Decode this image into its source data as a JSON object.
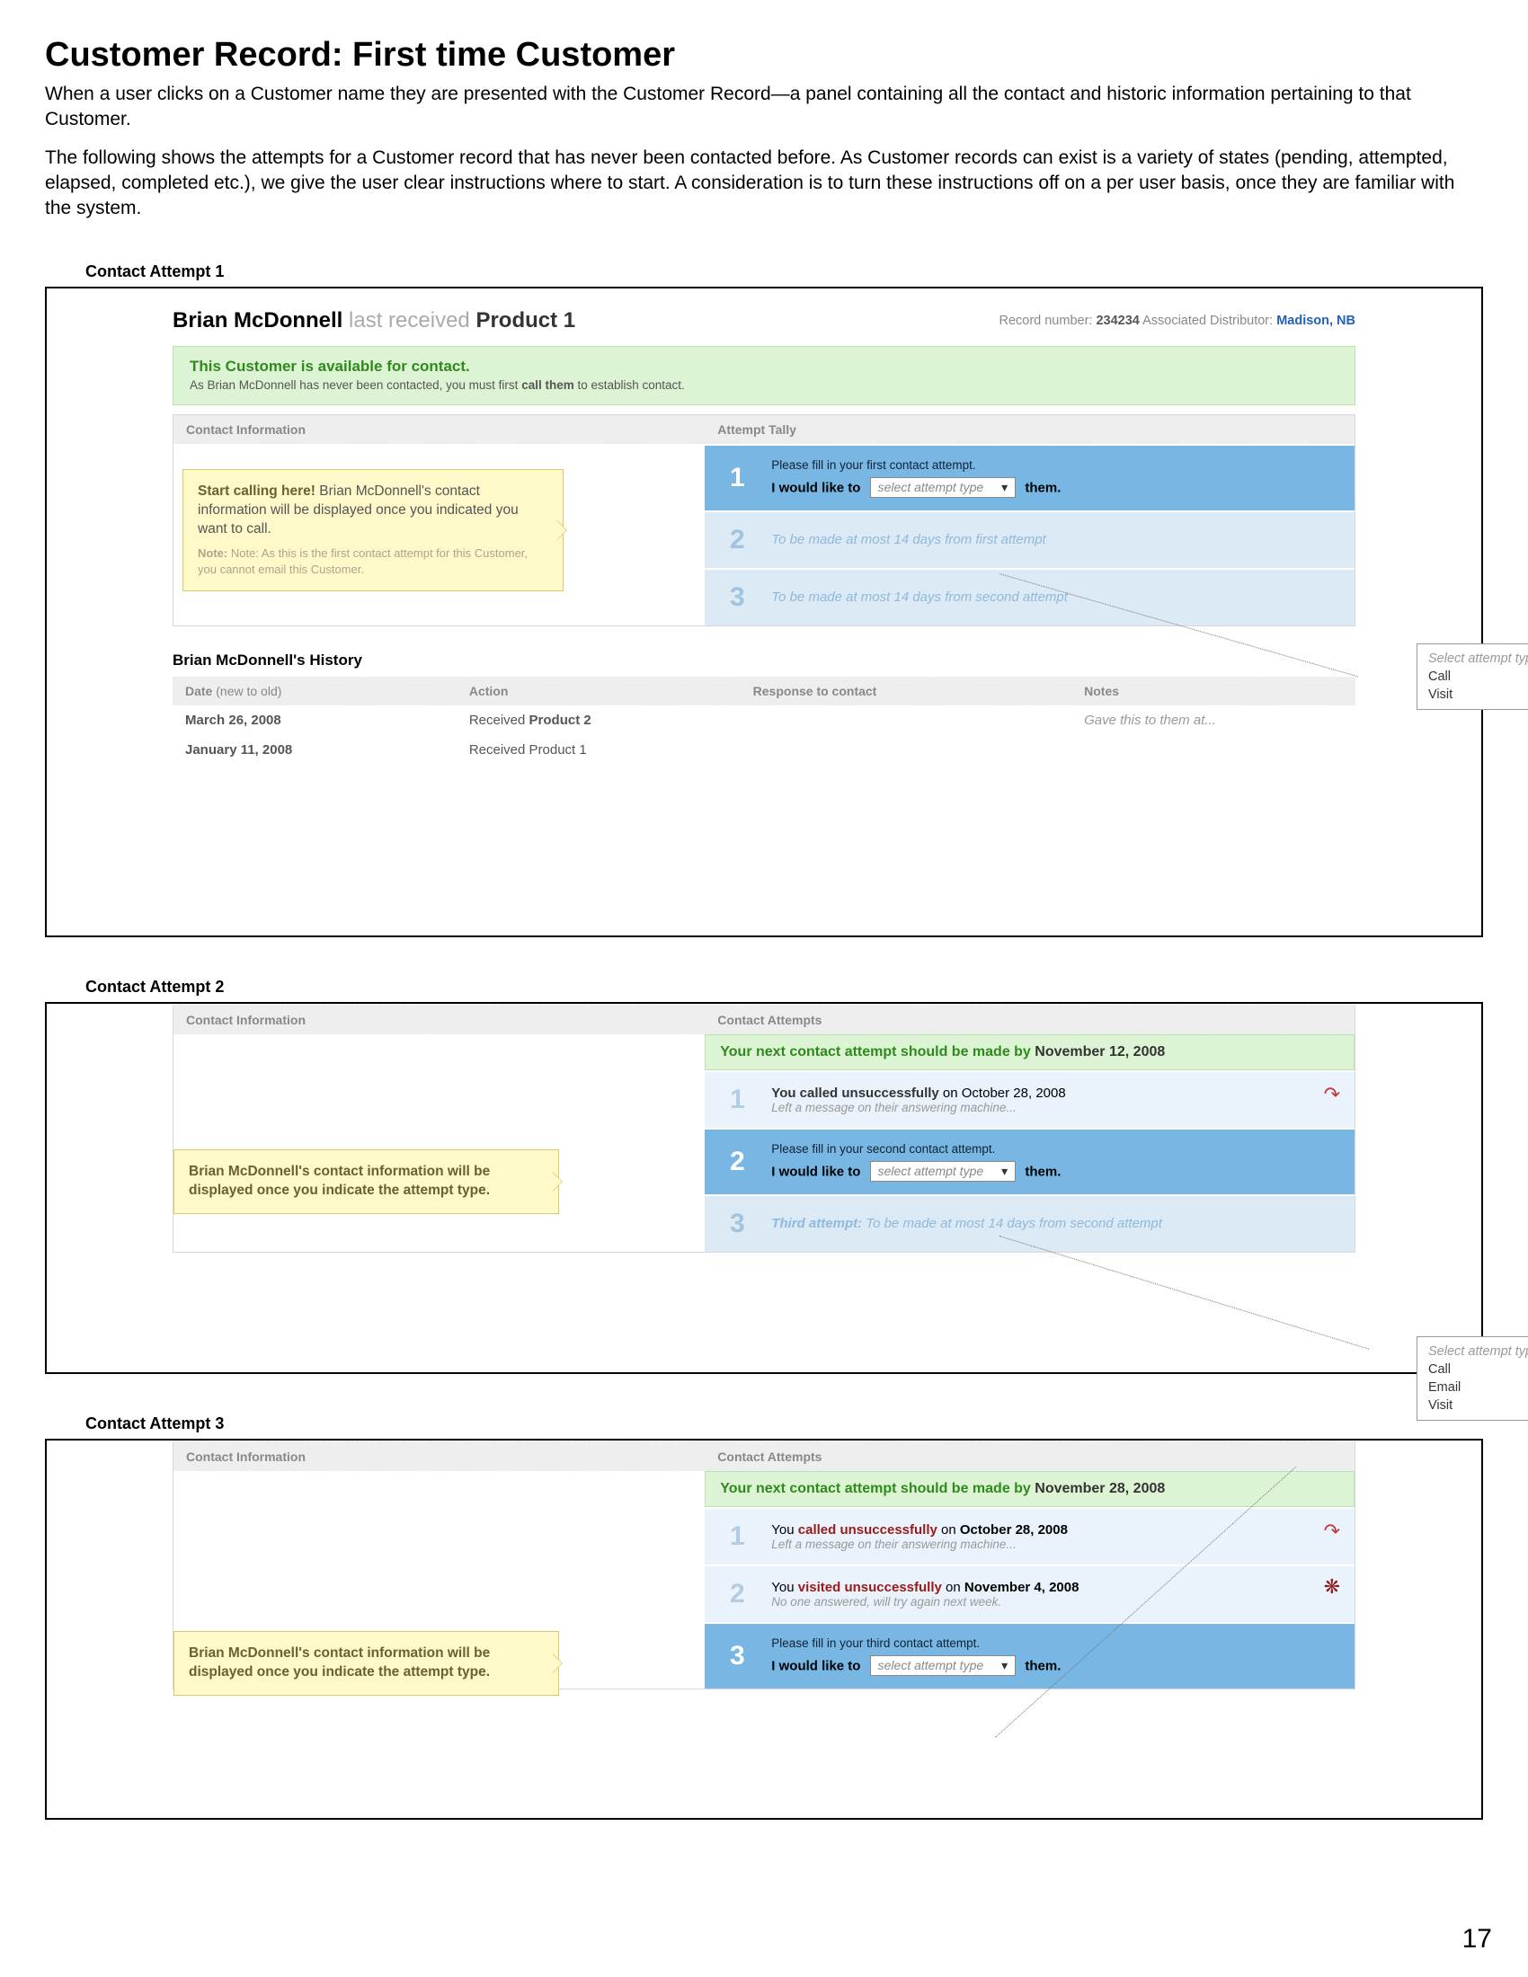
{
  "page": {
    "title": "Customer Record: First time Customer",
    "intro1": "When a user clicks on a Customer name they are presented with the Customer Record—a panel containing all the contact and historic information pertaining to that Customer.",
    "intro2": "The following shows the attempts for a Customer record that has never been contacted before. As Customer records can exist is a variety of states (pending, attempted, elapsed, completed etc.), we give the user clear instructions where to start. A consideration is to turn these instructions off on a per user basis, once they are familiar with the system.",
    "number": "17"
  },
  "customer": {
    "name": "Brian McDonnell",
    "last_received_prefix": " last received ",
    "last_received_product": "Product 1",
    "record_label": "Record number: ",
    "record_number": "234234",
    "distributor_label": "  Associated Distributor: ",
    "distributor": "Madison, NB"
  },
  "banner": {
    "title": "This Customer is available for contact.",
    "sub_a": "As Brian McDonnell has never been contacted, you must first ",
    "sub_b": "call them",
    "sub_c": " to establish contact."
  },
  "headers": {
    "contact_info": "Contact Information",
    "attempt_tally": "Attempt Tally",
    "contact_attempts": "Contact Attempts"
  },
  "attempt_rows": {
    "fill1": "Please fill in your first contact attempt.",
    "fill2": "Please fill in your second contact attempt.",
    "fill3": "Please fill in your third contact attempt.",
    "would": "I would like to",
    "them": "them.",
    "select_ph": "select attempt type",
    "future2": "To be made at most 14 days from first attempt",
    "future3": "To be made at most 14 days from second attempt",
    "third_prefix": "Third attempt:",
    "third_rest": " To be made at most 14 days from second attempt"
  },
  "callouts": {
    "c1a": "Start calling here!",
    "c1b": " Brian McDonnell's contact information will be displayed once you indicated you want to call.",
    "c1note": "Note: As this is the first contact attempt for this Customer, you cannot email this Customer.",
    "c2": "Brian McDonnell's contact information will be displayed once you indicate the attempt type.",
    "c3": "Brian McDonnell's contact information will be displayed once you indicate the attempt type."
  },
  "popup": {
    "ph": "Select attempt type",
    "call": "Call",
    "email": "Email",
    "visit": "Visit"
  },
  "sections": {
    "s1": "Contact Attempt 1",
    "s2": "Contact Attempt 2",
    "s3": "Contact Attempt 3"
  },
  "next": {
    "prefix": "Your next contact attempt should be made by ",
    "d2": "November 12, 2008",
    "d3": "November 28, 2008"
  },
  "results": {
    "r1_a": "You ",
    "r1_b": "called unsuccessfully",
    "r1_c": " on ",
    "r1_date": "October 28, 2008",
    "r1_sub": "Left a message on their answering machine...",
    "r2_a": "You ",
    "r2_b": "visited unsuccessfully",
    "r2_c": " on ",
    "r2_date": "November 4, 2008",
    "r2_sub": "No one answered, will try again next week."
  },
  "called_bold": "You called unsuccessfully",
  "called_rest": " on October 28, 2008",
  "history": {
    "title": "Brian McDonnell's History",
    "h_date": "Date",
    "h_date_sub": " (new to old)",
    "h_action": "Action",
    "h_resp": "Response to contact",
    "h_notes": "Notes",
    "rows": [
      {
        "date": "March 26, 2008",
        "action_a": "Received ",
        "action_b": "Product 2",
        "notes": "Gave this to them at..."
      },
      {
        "date": "January 11, 2008",
        "action_a": "Received Product 1",
        "action_b": "",
        "notes": ""
      }
    ]
  }
}
